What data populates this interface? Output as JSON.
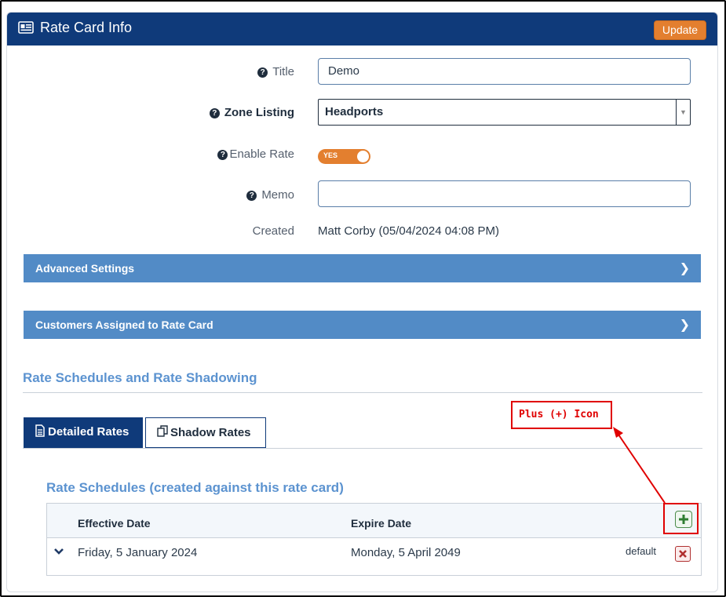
{
  "header": {
    "title": "Rate Card Info",
    "update_label": "Update",
    "icon": "id-card-icon",
    "bg_color": "#0f3a7a",
    "update_color": "#e37f2f"
  },
  "form": {
    "title_label": "Title",
    "title_value": "Demo",
    "zone_label": "Zone Listing",
    "zone_value": "Headports",
    "enable_label": "Enable Rate",
    "enable_value": "YES",
    "memo_label": "Memo",
    "memo_value": "",
    "created_label": "Created",
    "created_value": "Matt Corby (05/04/2024 04:08 PM)",
    "help_icon_glyph": "?"
  },
  "panels": {
    "advanced": "Advanced Settings",
    "customers": "Customers Assigned to Rate Card",
    "chevron_glyph": "❯"
  },
  "schedules_section": {
    "title": "Rate Schedules and Rate Shadowing",
    "tabs": [
      {
        "label": "Detailed Rates",
        "active": true,
        "icon": "document-icon"
      },
      {
        "label": "Shadow Rates",
        "active": false,
        "icon": "copy-icon"
      }
    ],
    "sub_title": "Rate Schedules (created against this rate card)",
    "columns": [
      "Effective Date",
      "Expire Date"
    ],
    "rows": [
      {
        "effective": "Friday, 5 January 2024",
        "expire": "Monday, 5 April 2049",
        "tag": "default"
      }
    ]
  },
  "annotation": {
    "label": "Plus (+) Icon",
    "color": "#e00000"
  }
}
